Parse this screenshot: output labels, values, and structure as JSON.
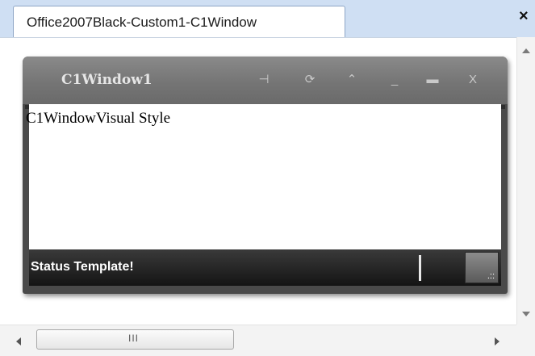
{
  "tab": {
    "label": "Office2007Black-Custom1-C1Window",
    "close_glyph": "×"
  },
  "c1window": {
    "title": "C1Window1",
    "content_text": "C1WindowVisual Style",
    "status_text": "Status Template!",
    "buttons": [
      {
        "name": "pin-icon",
        "glyph": "⊣"
      },
      {
        "name": "refresh-icon",
        "glyph": "⟳"
      },
      {
        "name": "collapse-icon",
        "glyph": "⌃"
      },
      {
        "name": "minimize-icon",
        "glyph": "_"
      },
      {
        "name": "maximize-icon",
        "glyph": "▬"
      },
      {
        "name": "close-icon",
        "glyph": "X"
      }
    ]
  },
  "scrollbar": {
    "thumb_grip": "III"
  },
  "colors": {
    "tabbar": "#cfdff3",
    "window": "#4a4a4a",
    "status_bg": "#1f1f1f"
  }
}
